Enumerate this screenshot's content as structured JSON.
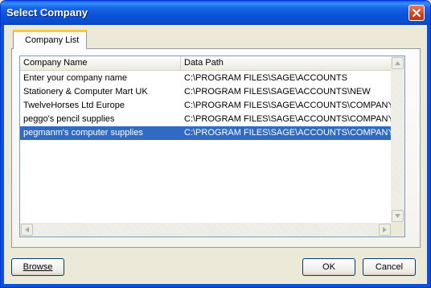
{
  "window": {
    "title": "Select Company"
  },
  "tabs": [
    {
      "label": "Company List"
    }
  ],
  "list": {
    "columns": [
      "Company Name",
      "Data Path"
    ],
    "rows": [
      {
        "name": "Enter your company name",
        "path": "C:\\PROGRAM FILES\\SAGE\\ACCOUNTS",
        "selected": false
      },
      {
        "name": "Stationery & Computer Mart UK",
        "path": "C:\\PROGRAM FILES\\SAGE\\ACCOUNTS\\NEW",
        "selected": false
      },
      {
        "name": "TwelveHorses Ltd Europe",
        "path": "C:\\PROGRAM FILES\\SAGE\\ACCOUNTS\\COMPANY.",
        "selected": false
      },
      {
        "name": "peggo's pencil supplies",
        "path": "C:\\PROGRAM FILES\\SAGE\\ACCOUNTS\\COMPANY.",
        "selected": false
      },
      {
        "name": "pegmanm's computer supplies",
        "path": "C:\\PROGRAM FILES\\SAGE\\ACCOUNTS\\COMPANY",
        "selected": true
      }
    ]
  },
  "buttons": {
    "browse_label": "Browse",
    "ok_label": "OK",
    "cancel_label": "Cancel"
  },
  "colors": {
    "titlebar": "#0b52d8",
    "selection": "#316ac5",
    "dialog_bg": "#ece9d8",
    "close_button": "#d2421c"
  },
  "icons": {
    "close": "close-icon",
    "scroll_up": "chevron-up-icon",
    "scroll_down": "chevron-down-icon",
    "scroll_left": "chevron-left-icon",
    "scroll_right": "chevron-right-icon"
  }
}
